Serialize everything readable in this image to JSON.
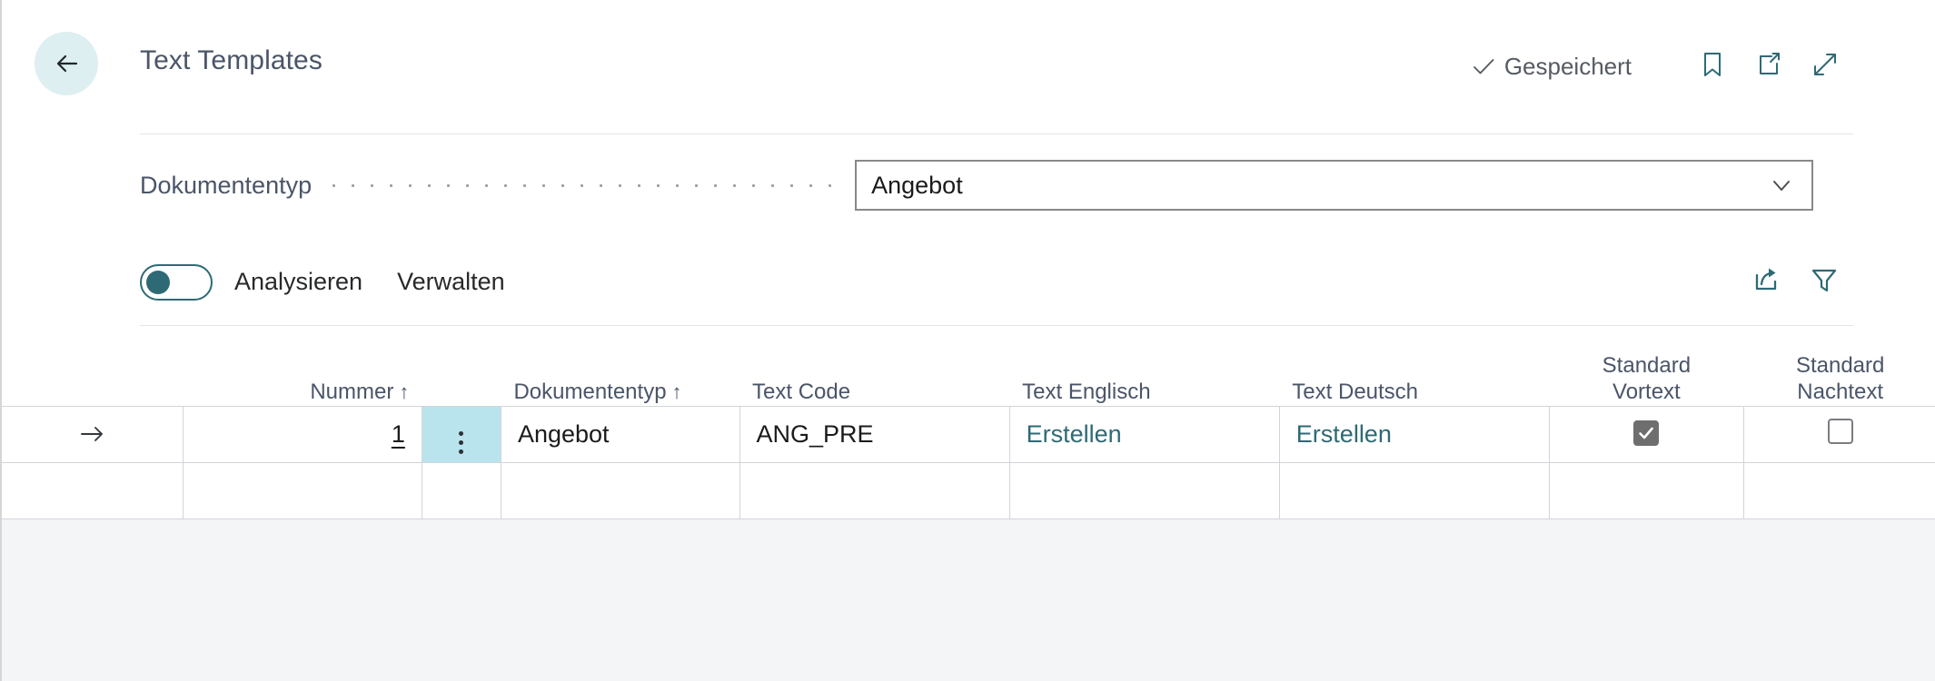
{
  "header": {
    "back_icon": "arrow-left-icon",
    "title": "Text Templates",
    "saved_label": "Gespeichert",
    "saved_check_icon": "check-icon",
    "bookmark_icon": "bookmark-icon",
    "open_new_window_icon": "open-in-new-window-icon",
    "expand_icon": "expand-diagonal-icon"
  },
  "field": {
    "label": "Dokumententyp",
    "value": "Angebot",
    "placeholder": "",
    "chevron_icon": "chevron-down-icon",
    "options": [
      "Angebot"
    ]
  },
  "toolbar": {
    "toggle_state": "off",
    "toggle_name": "analysieren-toggle",
    "actions": [
      {
        "label": "Analysieren"
      },
      {
        "label": "Verwalten"
      }
    ],
    "share_icon": "share-export-icon",
    "filter_icon": "filter-funnel-icon"
  },
  "table": {
    "columns": [
      {
        "label": "",
        "align": "center",
        "sort": ""
      },
      {
        "label": "Nummer",
        "align": "right",
        "sort": "asc"
      },
      {
        "label": "",
        "align": "center",
        "sort": ""
      },
      {
        "label": "Dokumententyp",
        "align": "left",
        "sort": "asc"
      },
      {
        "label": "Text Code",
        "align": "left",
        "sort": ""
      },
      {
        "label": "Text Englisch",
        "align": "left",
        "sort": ""
      },
      {
        "label": "Text Deutsch",
        "align": "left",
        "sort": ""
      },
      {
        "label": "Standard Vortext",
        "align": "center",
        "sort": ""
      },
      {
        "label": "Standard Nachtext",
        "align": "center",
        "sort": ""
      }
    ],
    "sort_asc_glyph": "↑",
    "row_indicator_icon": "arrow-right-icon",
    "row_menu_icon": "kebab-menu-icon",
    "rows": [
      {
        "nummer": "1",
        "dokumententyp": "Angebot",
        "text_code": "ANG_PRE",
        "text_englisch": "Erstellen",
        "text_deutsch": "Erstellen",
        "standard_vortext": true,
        "standard_nachtext": false
      }
    ]
  },
  "colors": {
    "accent_teal": "#2e6a75",
    "link_teal": "#2d6a75",
    "back_circle": "#ddeff0",
    "cell_highlight": "#b9e4ed",
    "header_text": "#4a5568",
    "footer_strip": "#f4f5f7",
    "grid_line": "#d2d4d9"
  }
}
